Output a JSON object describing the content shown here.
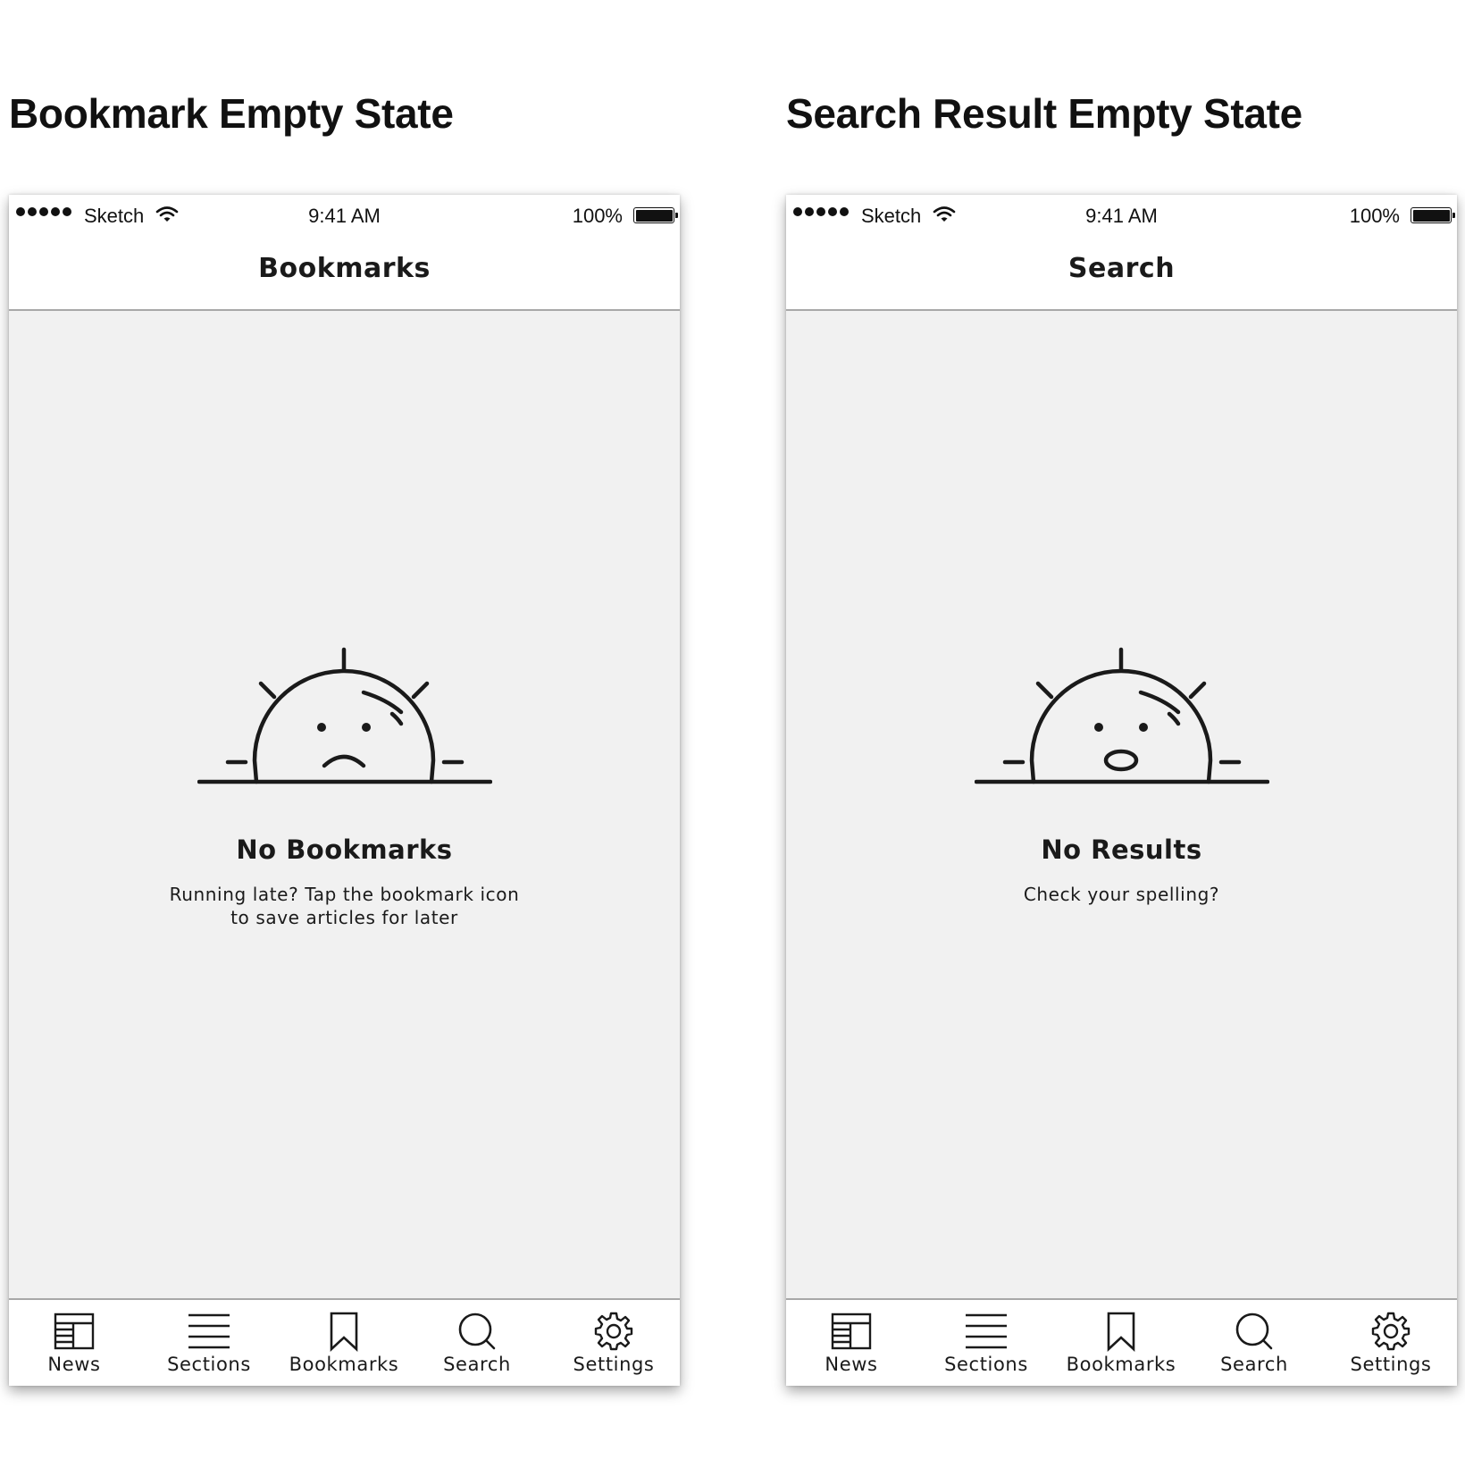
{
  "screens": [
    {
      "heading": "Bookmark Empty State",
      "status": {
        "carrier": "Sketch",
        "time": "9:41 AM",
        "battery": "100%",
        "signal_bars": 5
      },
      "nav_title": "Bookmarks",
      "empty": {
        "face": "frown",
        "title": "No Bookmarks",
        "lines": [
          "Running late? Tap the bookmark icon",
          "to save articles for later"
        ]
      },
      "tabs": [
        {
          "label": "News",
          "icon": "newspaper-icon"
        },
        {
          "label": "Sections",
          "icon": "menu-lines-icon"
        },
        {
          "label": "Bookmarks",
          "icon": "bookmark-icon"
        },
        {
          "label": "Search",
          "icon": "search-icon"
        },
        {
          "label": "Settings",
          "icon": "gear-icon"
        }
      ]
    },
    {
      "heading": "Search Result Empty State",
      "status": {
        "carrier": "Sketch",
        "time": "9:41 AM",
        "battery": "100%",
        "signal_bars": 5
      },
      "nav_title": "Search",
      "empty": {
        "face": "surprised",
        "title": "No Results",
        "lines": [
          "Check your spelling?"
        ]
      },
      "tabs": [
        {
          "label": "News",
          "icon": "newspaper-icon"
        },
        {
          "label": "Sections",
          "icon": "menu-lines-icon"
        },
        {
          "label": "Bookmarks",
          "icon": "bookmark-icon"
        },
        {
          "label": "Search",
          "icon": "search-icon"
        },
        {
          "label": "Settings",
          "icon": "gear-icon"
        }
      ]
    }
  ],
  "colors": {
    "ink": "#1a1a1a",
    "content_background": "#f1f1f1",
    "bar_background": "#ffffff",
    "divider": "#a8a8a8"
  }
}
